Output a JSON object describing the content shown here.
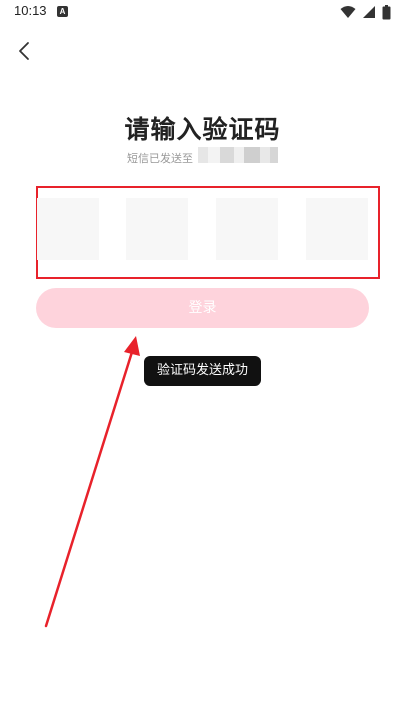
{
  "status_bar": {
    "time": "10:13",
    "notification_badge": "A",
    "icons": [
      "wifi-icon",
      "signal-icon",
      "battery-icon"
    ]
  },
  "header": {
    "back_icon": "back-arrow-icon"
  },
  "main": {
    "title": "请输入验证码",
    "subtitle": "短信已发送至",
    "code_cells": 4,
    "login_label": "登录"
  },
  "toast": {
    "message": "验证码发送成功"
  },
  "colors": {
    "highlight_border": "#e8222b",
    "login_button_bg": "#fed3dc",
    "code_cell_bg": "#f7f7f7",
    "toast_bg": "#111111",
    "annotation_arrow": "#e8222b"
  }
}
